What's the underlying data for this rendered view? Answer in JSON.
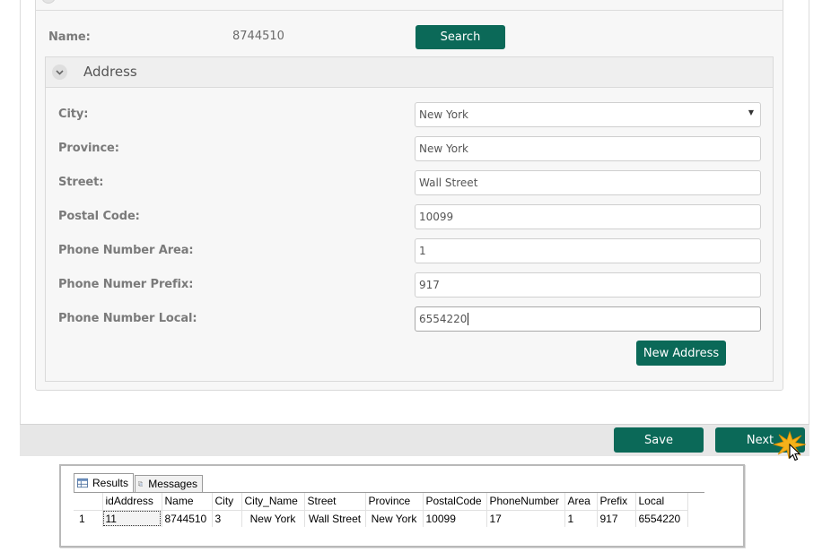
{
  "form": {
    "name_label": "Name:",
    "name_value": "8744510",
    "search_button": "Search"
  },
  "address": {
    "title": "Address",
    "fields": [
      {
        "label": "City:",
        "value": "New York",
        "type": "select"
      },
      {
        "label": "Province:",
        "value": "New York"
      },
      {
        "label": "Street:",
        "value": "Wall Street"
      },
      {
        "label": "Postal Code:",
        "value": "10099"
      },
      {
        "label": "Phone Number Area:",
        "value": "1"
      },
      {
        "label": "Phone Numer Prefix:",
        "value": "917"
      },
      {
        "label": "Phone Number Local:",
        "value": "6554220"
      }
    ],
    "new_address_button": "New Address"
  },
  "footer": {
    "save_button": "Save",
    "next_button": "Next"
  },
  "sql_results": {
    "tabs": [
      "Results",
      "Messages"
    ],
    "columns": [
      "idAddress",
      "Name",
      "City",
      "City_Name",
      "Street",
      "Province",
      "PostalCode",
      "PhoneNumber",
      "Area",
      "Prefix",
      "Local"
    ],
    "rows": [
      {
        "num": "1",
        "cells": [
          "11",
          "8744510",
          "3",
          "New York",
          "Wall Street",
          "New York",
          "10099",
          "17",
          "1",
          "917",
          "6554220"
        ]
      }
    ]
  },
  "colors": {
    "button_bg": "#0b6958",
    "panel_bg": "#f7f7f7",
    "footer_bg": "#e7e7e7"
  }
}
